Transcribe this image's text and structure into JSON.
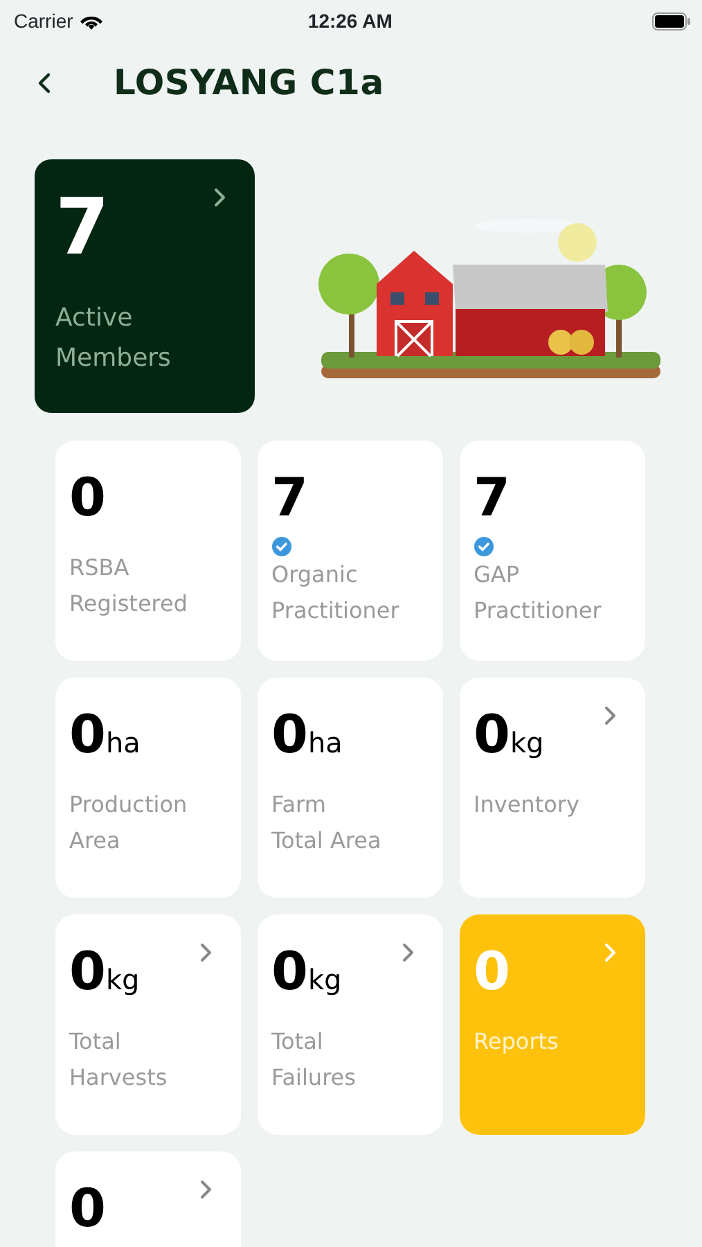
{
  "status_bar": {
    "carrier": "Carrier",
    "time": "12:26 AM"
  },
  "header": {
    "title": "LOSYANG C1a"
  },
  "members": {
    "value": "7",
    "label_lines": [
      "Active",
      "Members"
    ],
    "arrow": true
  },
  "tiles": [
    {
      "kind": "plain",
      "value": "0",
      "label_lines": [
        "RSBA",
        "Registered"
      ],
      "verified": false,
      "arrow": false
    },
    {
      "kind": "plain",
      "value": "7",
      "label_lines": [
        "Organic",
        "Practitioner"
      ],
      "verified": true,
      "arrow": false
    },
    {
      "kind": "plain",
      "value": "7",
      "label_lines": [
        "GAP",
        "Practitioner"
      ],
      "verified": true,
      "arrow": false
    },
    {
      "kind": "plain",
      "value": "0",
      "unit": "ha",
      "label_lines": [
        "Production",
        "Area"
      ],
      "verified": false,
      "arrow": false
    },
    {
      "kind": "plain",
      "value": "0",
      "unit": "ha",
      "label_lines": [
        "Farm",
        "Total Area"
      ],
      "verified": false,
      "arrow": false
    },
    {
      "kind": "plain",
      "value": "0",
      "unit": "kg",
      "label_lines": [
        "Inventory"
      ],
      "verified": false,
      "arrow": true
    },
    {
      "kind": "plain",
      "value": "0",
      "unit": "kg",
      "label_lines": [
        "Total",
        "Harvests"
      ],
      "verified": false,
      "arrow": true
    },
    {
      "kind": "plain",
      "value": "0",
      "unit": "kg",
      "label_lines": [
        "Total",
        "Failures"
      ],
      "verified": false,
      "arrow": true
    },
    {
      "kind": "highlight",
      "value": "0",
      "label_lines": [
        "Reports"
      ],
      "verified": false,
      "arrow": true
    },
    {
      "kind": "plain",
      "value": "0",
      "verified": false,
      "arrow": true
    }
  ]
}
